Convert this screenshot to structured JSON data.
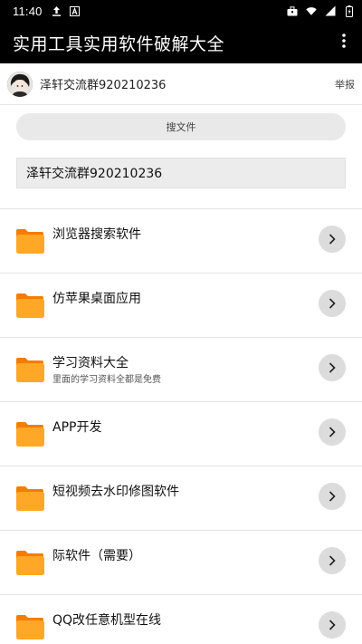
{
  "status_bar": {
    "time": "11:40",
    "left_icons": [
      "upload-icon",
      "app-a-icon"
    ],
    "right_icons": [
      "briefcase-icon",
      "wifi-icon",
      "signal-icon",
      "battery-icon"
    ]
  },
  "app_bar": {
    "title": "实用工具实用软件破解大全",
    "menu_icon": "more-vert-icon"
  },
  "publisher": {
    "name": "泽轩交流群920210236",
    "report_label": "举报"
  },
  "search": {
    "label": "搜文件"
  },
  "notice": {
    "text": "泽轩交流群920210236"
  },
  "items": [
    {
      "title": "浏览器搜索软件",
      "subtitle": ""
    },
    {
      "title": "仿苹果桌面应用",
      "subtitle": ""
    },
    {
      "title": "学习资料大全",
      "subtitle": "里面的学习资料全都是免费"
    },
    {
      "title": "APP开发",
      "subtitle": ""
    },
    {
      "title": "短视频去水印修图软件",
      "subtitle": ""
    },
    {
      "title": "际软件（需要）",
      "subtitle": ""
    },
    {
      "title": "QQ改任意机型在线",
      "subtitle": ""
    }
  ],
  "colors": {
    "bar_bg": "#000000",
    "folder_front": "#FFA726",
    "folder_back": "#F57C00",
    "chevron_bg": "#DCDCDC"
  }
}
